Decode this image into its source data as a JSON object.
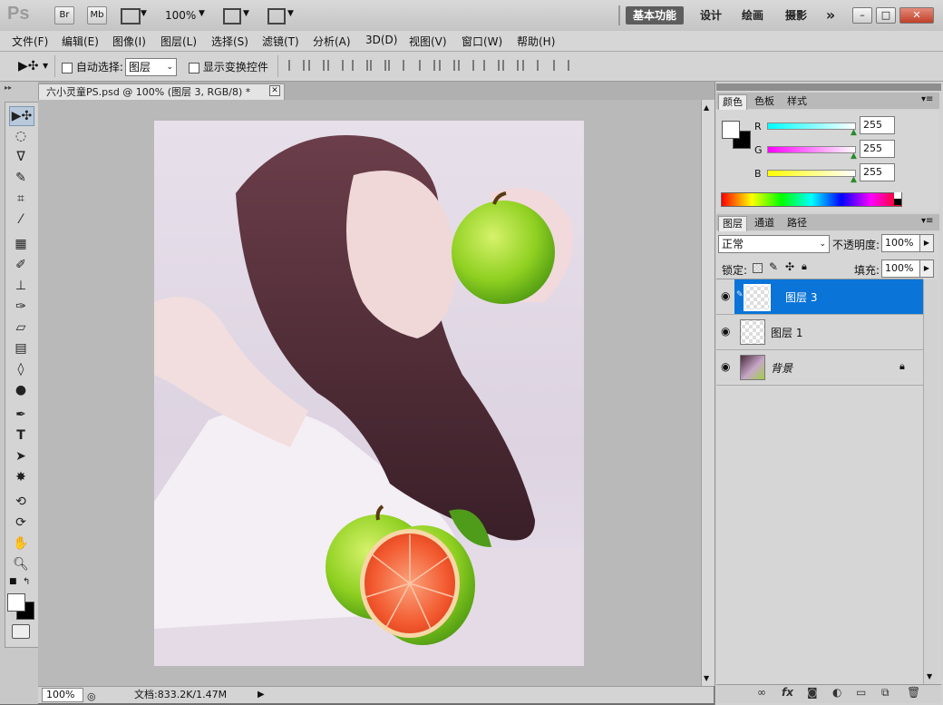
{
  "appbar": {
    "logo": "Ps",
    "bridge": "Br",
    "minibridge": "Mb",
    "zoom": "100%",
    "workspaces": [
      "基本功能",
      "设计",
      "绘画",
      "摄影"
    ],
    "more": "»"
  },
  "menu": [
    "文件(F)",
    "编辑(E)",
    "图像(I)",
    "图层(L)",
    "选择(S)",
    "滤镜(T)",
    "分析(A)",
    "3D(D)",
    "视图(V)",
    "窗口(W)",
    "帮助(H)"
  ],
  "options": {
    "auto_select_label": "自动选择:",
    "auto_select_value": "图层",
    "show_transform_label": "显示变换控件"
  },
  "document": {
    "tab_title": "六小灵童PS.psd @ 100% (图层 3, RGB/8) *",
    "zoom": "100%",
    "doc_size": "文档:833.2K/1.47M"
  },
  "color_panel": {
    "tabs": [
      "颜色",
      "色板",
      "样式"
    ],
    "channels": [
      {
        "label": "R",
        "value": "255",
        "color": "#36d6d6"
      },
      {
        "label": "G",
        "value": "255",
        "color": "#d636d6"
      },
      {
        "label": "B",
        "value": "255",
        "color": "#e8e834"
      }
    ]
  },
  "layers_panel": {
    "tabs": [
      "图层",
      "通道",
      "路径"
    ],
    "blend_mode": "正常",
    "opacity_label": "不透明度:",
    "opacity_value": "100%",
    "lock_label": "锁定:",
    "fill_label": "填充:",
    "fill_value": "100%",
    "layers": [
      {
        "name": "图层 3",
        "selected": true
      },
      {
        "name": "图层 1",
        "selected": false
      },
      {
        "name": "背景",
        "selected": false
      }
    ]
  },
  "colors": {
    "selection": "#0a74d8",
    "apple_green": "#8fd021",
    "grapefruit": "#f2582e"
  }
}
